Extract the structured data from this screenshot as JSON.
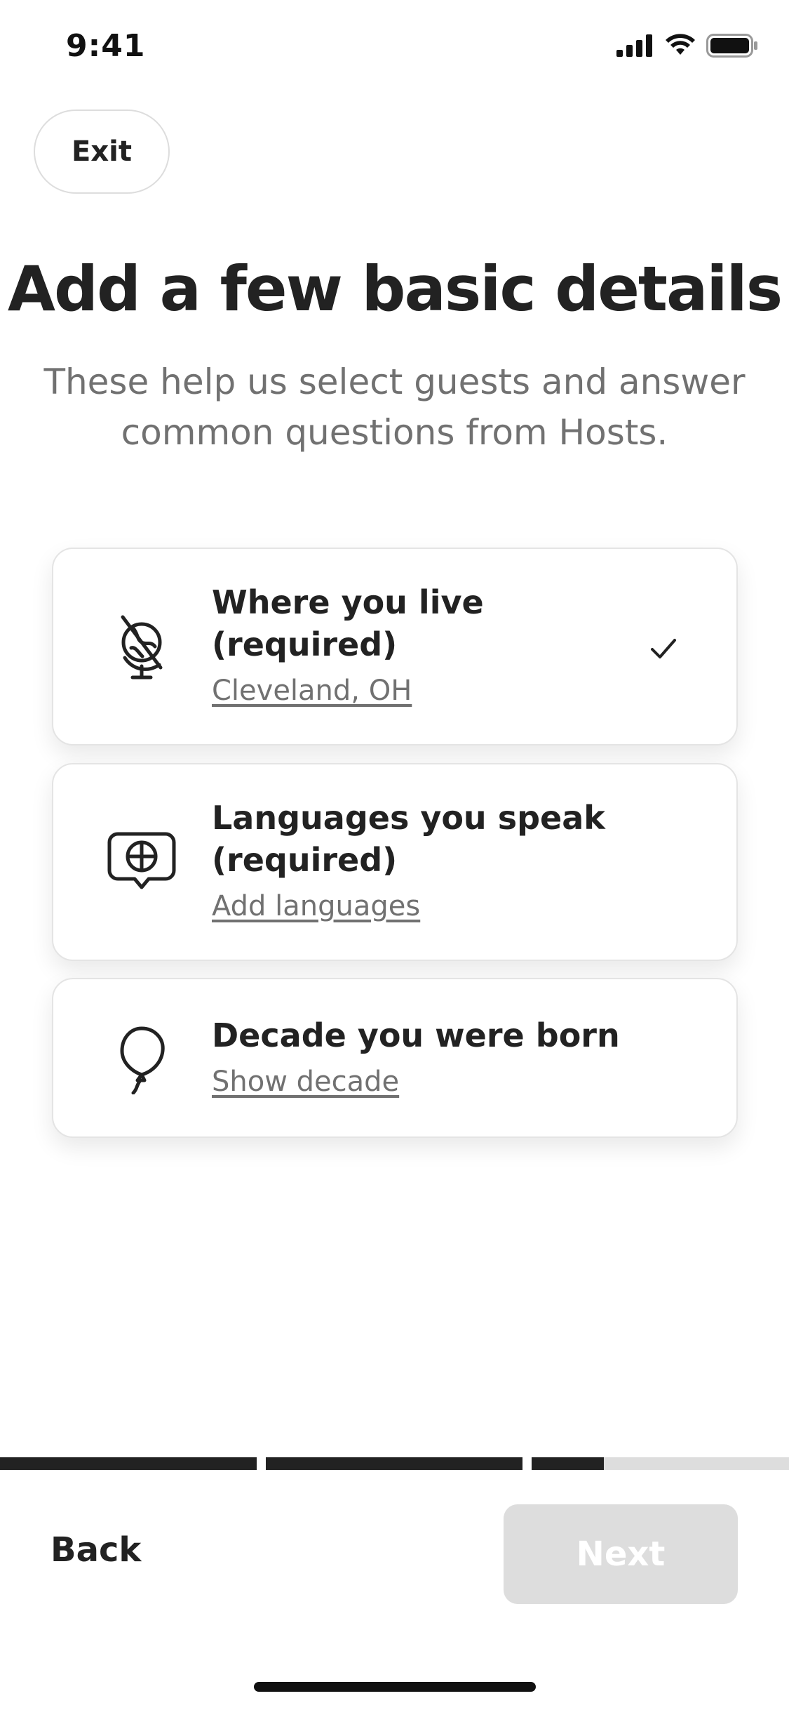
{
  "status_bar": {
    "time": "9:41",
    "icons": [
      "signal-icon",
      "wifi-icon",
      "battery-icon"
    ]
  },
  "header": {
    "exit_label": "Exit"
  },
  "main": {
    "title": "Add a few basic details",
    "subtitle": "These help us select guests and answer common questions from Hosts.",
    "cards": [
      {
        "icon": "globe-icon",
        "title": "Where you live\n(required)",
        "link": "Cleveland, OH",
        "completed": true
      },
      {
        "icon": "language-bubble-icon",
        "title": "Languages you speak\n(required)",
        "link": "Add languages",
        "completed": false
      },
      {
        "icon": "balloon-icon",
        "title": "Decade you were born",
        "link": "Show decade",
        "completed": false
      }
    ]
  },
  "progress": {
    "steps": 3,
    "current_step_fill": [
      1,
      1,
      0.28
    ]
  },
  "footer": {
    "back_label": "Back",
    "next_label": "Next",
    "next_enabled": false
  },
  "colors": {
    "text": "#222222",
    "muted": "#717171",
    "border": "#dddddd",
    "disabled": "#dddddd"
  }
}
